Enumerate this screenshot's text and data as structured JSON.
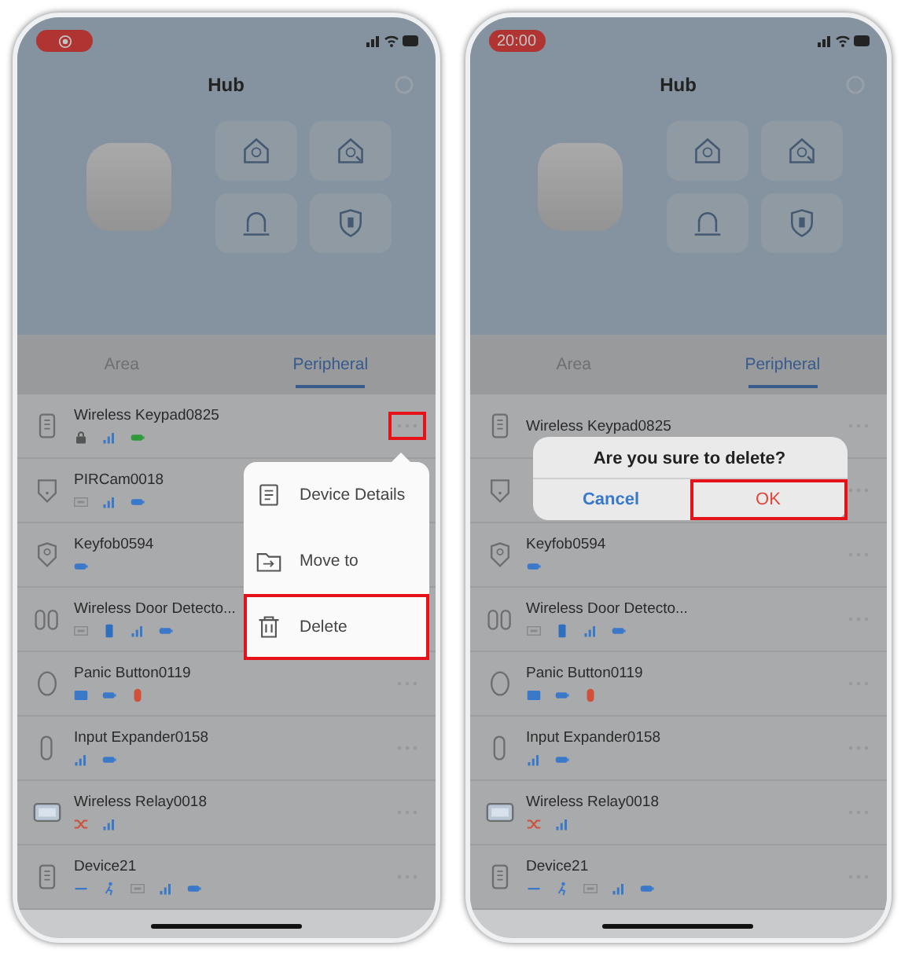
{
  "phones": [
    {
      "status_pill": {
        "kind": "recording"
      },
      "title": "Hub",
      "tiles": [
        {
          "kind": "home-arm"
        },
        {
          "kind": "home-partial"
        },
        {
          "kind": "siren"
        },
        {
          "kind": "shield"
        }
      ],
      "tabs": [
        {
          "label": "Area",
          "selected": false
        },
        {
          "label": "Peripheral",
          "selected": true
        }
      ],
      "devices": [
        {
          "kind": "keypad",
          "name": "Wireless Keypad0825",
          "more_highlighted": true,
          "status_icons": [
            {
              "kind": "lock",
              "color": "#555555"
            },
            {
              "kind": "signal",
              "color": "#3a78c9"
            },
            {
              "kind": "battery",
              "color": "#2e9a3a"
            }
          ]
        },
        {
          "kind": "camera",
          "name": "PIRCam0018",
          "status_icons": [
            {
              "kind": "sim",
              "color": "#8a8a8a"
            },
            {
              "kind": "signal",
              "color": "#3a78c9"
            },
            {
              "kind": "battery",
              "color": "#3a78c9"
            }
          ]
        },
        {
          "kind": "keyfob",
          "name": "Keyfob0594",
          "status_icons": [
            {
              "kind": "battery",
              "color": "#3a78c9"
            }
          ]
        },
        {
          "kind": "door",
          "name": "Wireless Door Detecto...",
          "status_icons": [
            {
              "kind": "sim",
              "color": "#8a8a8a"
            },
            {
              "kind": "contact",
              "color": "#2f6fc0"
            },
            {
              "kind": "signal",
              "color": "#3a78c9"
            },
            {
              "kind": "battery",
              "color": "#3a78c9"
            }
          ]
        },
        {
          "kind": "panic",
          "name": "Panic Button0119",
          "more_highlighted": false,
          "status_icons": [
            {
              "kind": "panel",
              "color": "#3a78c9"
            },
            {
              "kind": "battery",
              "color": "#3a78c9"
            },
            {
              "kind": "tamper",
              "color": "#d0503a"
            }
          ]
        },
        {
          "kind": "expander",
          "name": "Input Expander0158",
          "more_highlighted": false,
          "status_icons": [
            {
              "kind": "signal",
              "color": "#3a78c9"
            },
            {
              "kind": "battery",
              "color": "#3a78c9"
            }
          ]
        },
        {
          "kind": "relay",
          "name": "Wireless Relay0018",
          "more_highlighted": false,
          "status_icons": [
            {
              "kind": "shuffle",
              "color": "#d0503a"
            },
            {
              "kind": "signal",
              "color": "#3a78c9"
            }
          ]
        },
        {
          "kind": "keypad",
          "name": "Device21",
          "more_highlighted": false,
          "status_icons": [
            {
              "kind": "dash",
              "color": "#3a78c9"
            },
            {
              "kind": "person",
              "color": "#3a78c9"
            },
            {
              "kind": "sim",
              "color": "#8a8a8a"
            },
            {
              "kind": "signal",
              "color": "#3a78c9"
            },
            {
              "kind": "battery",
              "color": "#3a78c9"
            }
          ]
        }
      ],
      "overlay": {
        "kind": "menu",
        "items": [
          {
            "kind": "details",
            "label": "Device Details",
            "highlighted": false
          },
          {
            "kind": "move",
            "label": "Move to",
            "highlighted": false
          },
          {
            "kind": "delete",
            "label": "Delete",
            "highlighted": true
          }
        ]
      }
    },
    {
      "status_pill": {
        "kind": "time",
        "text": "20:00"
      },
      "title": "Hub",
      "tiles": [
        {
          "kind": "home-arm"
        },
        {
          "kind": "home-partial"
        },
        {
          "kind": "siren"
        },
        {
          "kind": "shield"
        }
      ],
      "tabs": [
        {
          "label": "Area",
          "selected": false
        },
        {
          "label": "Peripheral",
          "selected": true
        }
      ],
      "devices": [
        {
          "kind": "keypad",
          "name": "Wireless Keypad0825",
          "more_highlighted": false
        },
        {
          "kind": "camera",
          "more_highlighted": false
        },
        {
          "kind": "keyfob",
          "name": "Keyfob0594",
          "more_highlighted": false,
          "status_icons": [
            {
              "kind": "battery",
              "color": "#3a78c9"
            }
          ]
        },
        {
          "kind": "door",
          "name": "Wireless Door Detecto...",
          "more_highlighted": false,
          "status_icons": [
            {
              "kind": "sim",
              "color": "#8a8a8a"
            },
            {
              "kind": "contact",
              "color": "#2f6fc0"
            },
            {
              "kind": "signal",
              "color": "#3a78c9"
            },
            {
              "kind": "battery",
              "color": "#3a78c9"
            }
          ]
        },
        {
          "kind": "panic",
          "name": "Panic Button0119",
          "more_highlighted": false,
          "status_icons": [
            {
              "kind": "panel",
              "color": "#3a78c9"
            },
            {
              "kind": "battery",
              "color": "#3a78c9"
            },
            {
              "kind": "tamper",
              "color": "#d0503a"
            }
          ]
        },
        {
          "kind": "expander",
          "name": "Input Expander0158",
          "more_highlighted": false,
          "status_icons": [
            {
              "kind": "signal",
              "color": "#3a78c9"
            },
            {
              "kind": "battery",
              "color": "#3a78c9"
            }
          ]
        },
        {
          "kind": "relay",
          "name": "Wireless Relay0018",
          "more_highlighted": false,
          "status_icons": [
            {
              "kind": "shuffle",
              "color": "#d0503a"
            },
            {
              "kind": "signal",
              "color": "#3a78c9"
            }
          ]
        },
        {
          "kind": "keypad",
          "name": "Device21",
          "more_highlighted": false,
          "status_icons": [
            {
              "kind": "dash",
              "color": "#3a78c9"
            },
            {
              "kind": "person",
              "color": "#3a78c9"
            },
            {
              "kind": "sim",
              "color": "#8a8a8a"
            },
            {
              "kind": "signal",
              "color": "#3a78c9"
            },
            {
              "kind": "battery",
              "color": "#3a78c9"
            }
          ]
        }
      ],
      "overlay": {
        "kind": "dialog",
        "title": "Are you sure to delete?",
        "buttons": [
          {
            "kind": "cancel",
            "label": "Cancel",
            "highlighted": false
          },
          {
            "kind": "ok",
            "label": "OK",
            "highlighted": true
          }
        ]
      }
    }
  ]
}
